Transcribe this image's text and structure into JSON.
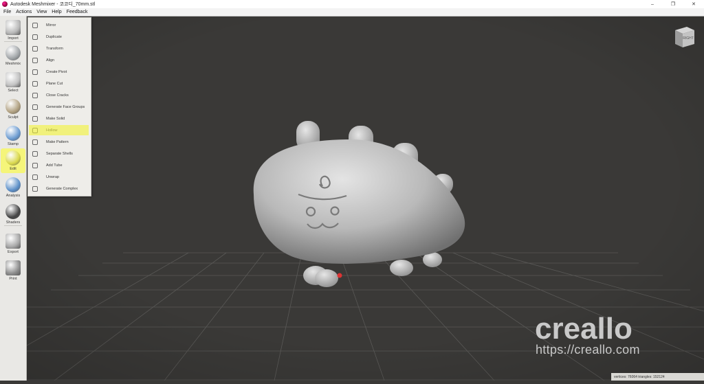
{
  "window": {
    "title": "Autodesk Meshmixer - 코코디_70mm.stl",
    "minimize": "–",
    "restore": "❐",
    "close": "✕"
  },
  "menu": [
    "File",
    "Actions",
    "View",
    "Help",
    "Feedback"
  ],
  "toolbar": [
    {
      "label": "Import",
      "icon": "plus-icon"
    },
    {
      "label": "Meshmix",
      "icon": "meshmix-icon"
    },
    {
      "label": "Select",
      "icon": "select-icon"
    },
    {
      "label": "Sculpt",
      "icon": "sculpt-icon"
    },
    {
      "label": "Stamp",
      "icon": "stamp-icon"
    },
    {
      "label": "Edit",
      "icon": "edit-icon",
      "active": true
    },
    {
      "label": "Analysis",
      "icon": "analysis-icon"
    },
    {
      "label": "Shaders",
      "icon": "shaders-icon"
    },
    {
      "label": "Export",
      "icon": "export-icon"
    },
    {
      "label": "Print",
      "icon": "print-icon"
    }
  ],
  "edit_menu": [
    {
      "label": "Mirror"
    },
    {
      "label": "Duplicate"
    },
    {
      "label": "Transform"
    },
    {
      "label": "Align"
    },
    {
      "label": "Create Pivot"
    },
    {
      "label": "Plane Cut"
    },
    {
      "label": "Close Cracks"
    },
    {
      "label": "Generate Face Groups"
    },
    {
      "label": "Make Solid"
    },
    {
      "label": "Hollow",
      "active": true
    },
    {
      "label": "Make Pattern"
    },
    {
      "label": "Separate Shells"
    },
    {
      "label": "Add Tube"
    },
    {
      "label": "Unwrap"
    },
    {
      "label": "Generate Complex"
    }
  ],
  "viewcube": {
    "label": "RIGHT"
  },
  "watermark": {
    "logo": "creallo",
    "url": "https://creallo.com"
  },
  "status": {
    "text": "vertices: 76064 triangles: 152124"
  },
  "colors": {
    "viewport_bg": "#3a3937",
    "highlight": "#f1f17c",
    "model": "#b8b8b8"
  }
}
